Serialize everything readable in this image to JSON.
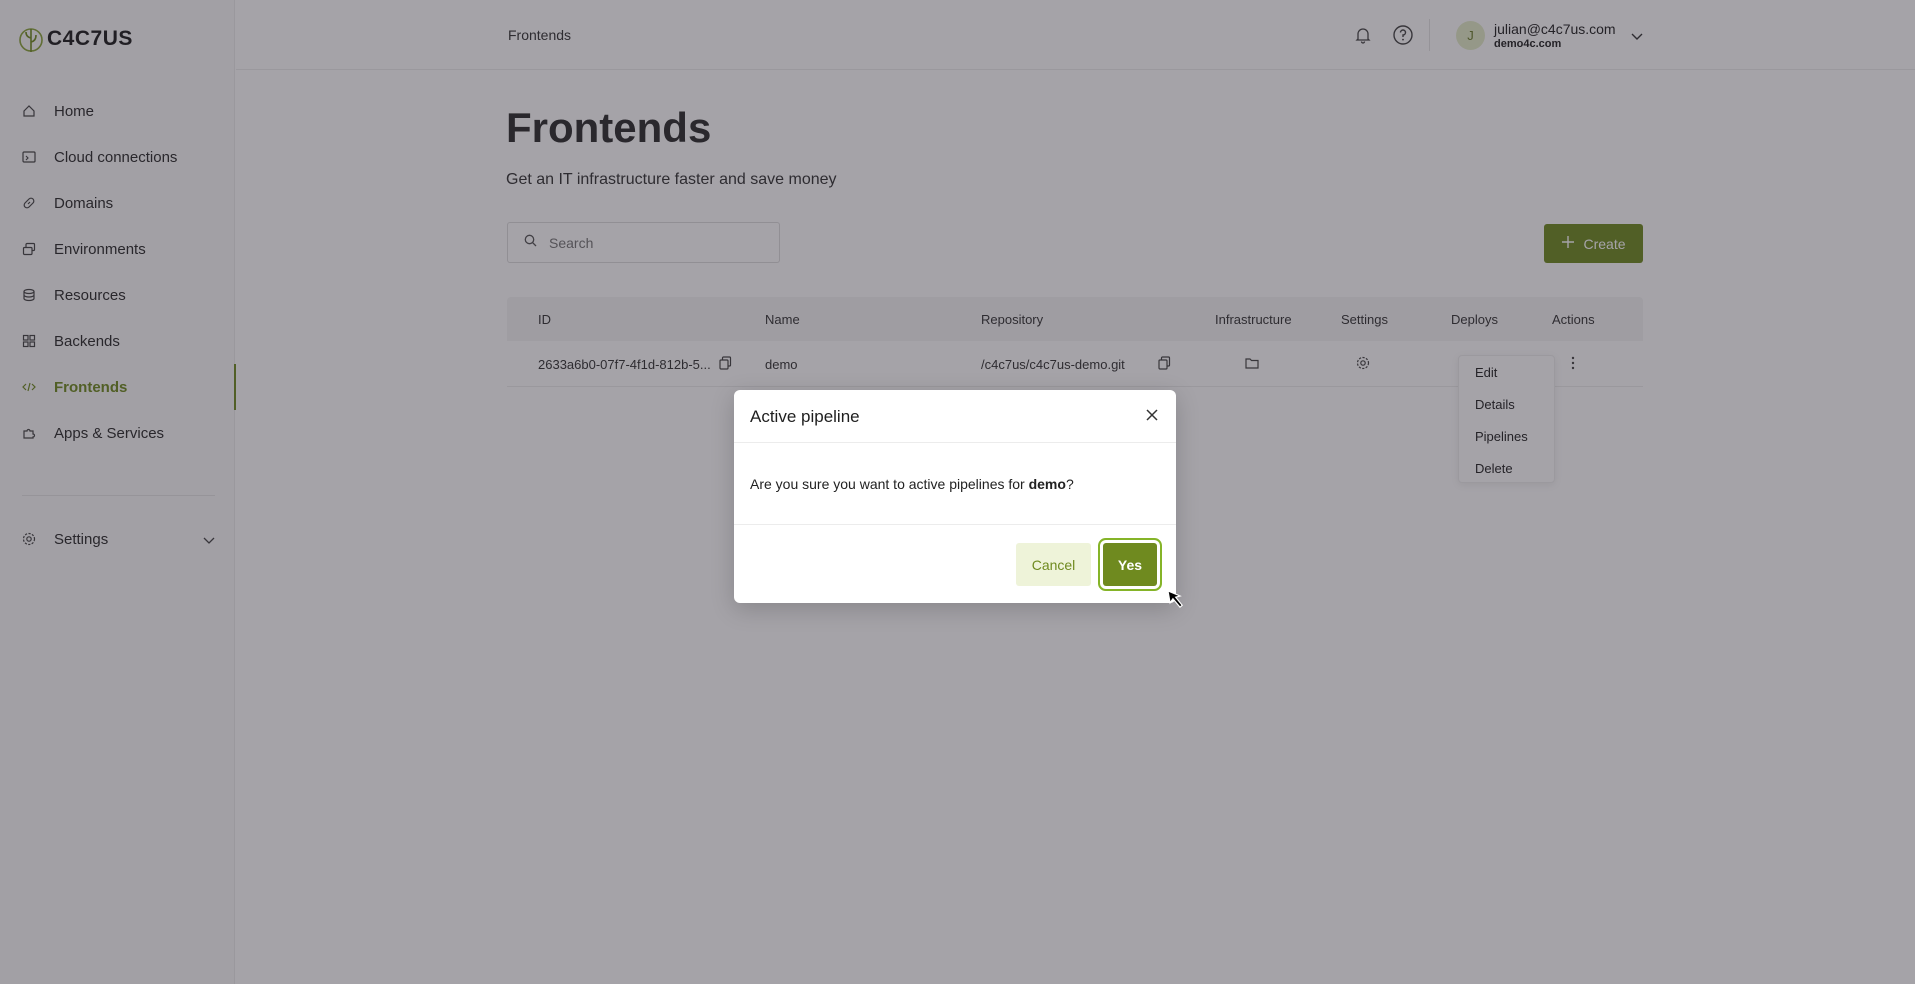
{
  "brand": {
    "name": "C4C7US",
    "accent": "#6f8a1f"
  },
  "sidebar": {
    "items": [
      {
        "label": "Home",
        "icon": "home-icon"
      },
      {
        "label": "Cloud connections",
        "icon": "terminal-icon"
      },
      {
        "label": "Domains",
        "icon": "link-icon"
      },
      {
        "label": "Environments",
        "icon": "layers-icon"
      },
      {
        "label": "Resources",
        "icon": "database-icon"
      },
      {
        "label": "Backends",
        "icon": "grid-icon"
      },
      {
        "label": "Frontends",
        "icon": "code-icon",
        "active": true
      },
      {
        "label": "Apps & Services",
        "icon": "puzzle-icon"
      }
    ],
    "settings_label": "Settings"
  },
  "header": {
    "breadcrumb": "Frontends",
    "user_email": "julian@c4c7us.com",
    "user_org": "demo4c.com",
    "avatar_initial": "J"
  },
  "main": {
    "title": "Frontends",
    "subtitle": "Get an IT infrastructure faster and save money",
    "search_placeholder": "Search",
    "create_label": "Create"
  },
  "table": {
    "columns": [
      "ID",
      "Name",
      "Repository",
      "Infrastructure",
      "Settings",
      "Deploys",
      "Actions"
    ],
    "rows": [
      {
        "id": "2633a6b0-07f7-4f1d-812b-5...",
        "name": "demo",
        "repository": "/c4c7us/c4c7us-demo.git"
      }
    ]
  },
  "context_menu": {
    "items": [
      "Edit",
      "Details",
      "Pipelines",
      "Delete"
    ]
  },
  "modal": {
    "title": "Active pipeline",
    "body_prefix": "Are you sure you want to active pipelines for ",
    "body_name": "demo",
    "body_suffix": "?",
    "cancel_label": "Cancel",
    "confirm_label": "Yes"
  }
}
